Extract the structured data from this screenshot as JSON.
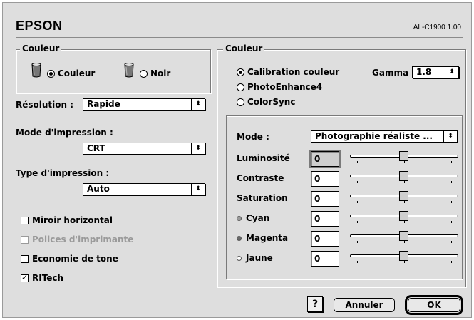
{
  "header": {
    "brand": "EPSON",
    "model": "AL-C1900  1.00"
  },
  "left": {
    "couleur_group_title": "Couleur",
    "color_options": [
      {
        "label": "Couleur",
        "selected": true
      },
      {
        "label": "Noir",
        "selected": false
      }
    ],
    "resolution_label": "Résolution :",
    "resolution_value": "Rapide",
    "print_mode_label": "Mode d'impression :",
    "print_mode_value": "CRT",
    "print_type_label": "Type d'impression :",
    "print_type_value": "Auto",
    "checkboxes": [
      {
        "label": "Miroir horizontal",
        "checked": false,
        "enabled": true
      },
      {
        "label": "Polices d'imprimante",
        "checked": false,
        "enabled": false
      },
      {
        "label": "Economie de tone",
        "checked": false,
        "enabled": true
      },
      {
        "label": "RITech",
        "checked": true,
        "enabled": true
      }
    ]
  },
  "right": {
    "group_title": "Couleur",
    "options": [
      {
        "label": "Calibration couleur",
        "selected": true
      },
      {
        "label": "PhotoEnhance4",
        "selected": false
      },
      {
        "label": "ColorSync",
        "selected": false
      }
    ],
    "gamma_label": "Gamma",
    "gamma_value": "1.8",
    "mode_label": "Mode :",
    "mode_value": "Photographie réaliste ...",
    "sliders": [
      {
        "label": "Luminosité",
        "value": "0",
        "dot": "",
        "level": 0.5
      },
      {
        "label": "Contraste",
        "value": "0",
        "dot": "",
        "level": 0.5
      },
      {
        "label": "Saturation",
        "value": "0",
        "dot": "",
        "level": 0.5
      },
      {
        "label": "Cyan",
        "value": "0",
        "dot": "cyan",
        "level": 0.5
      },
      {
        "label": "Magenta",
        "value": "0",
        "dot": "magenta",
        "level": 0.5
      },
      {
        "label": "Jaune",
        "value": "0",
        "dot": "yellow",
        "level": 0.5
      }
    ],
    "dot_colors": {
      "cyan": "#9a9a9a",
      "magenta": "#6a6a6a",
      "yellow": "#ffffff"
    }
  },
  "buttons": {
    "help": "?",
    "cancel": "Annuler",
    "ok": "OK"
  },
  "icons": {
    "popup": "up-down-arrows-icon",
    "ink": "ink-bucket-icon"
  }
}
